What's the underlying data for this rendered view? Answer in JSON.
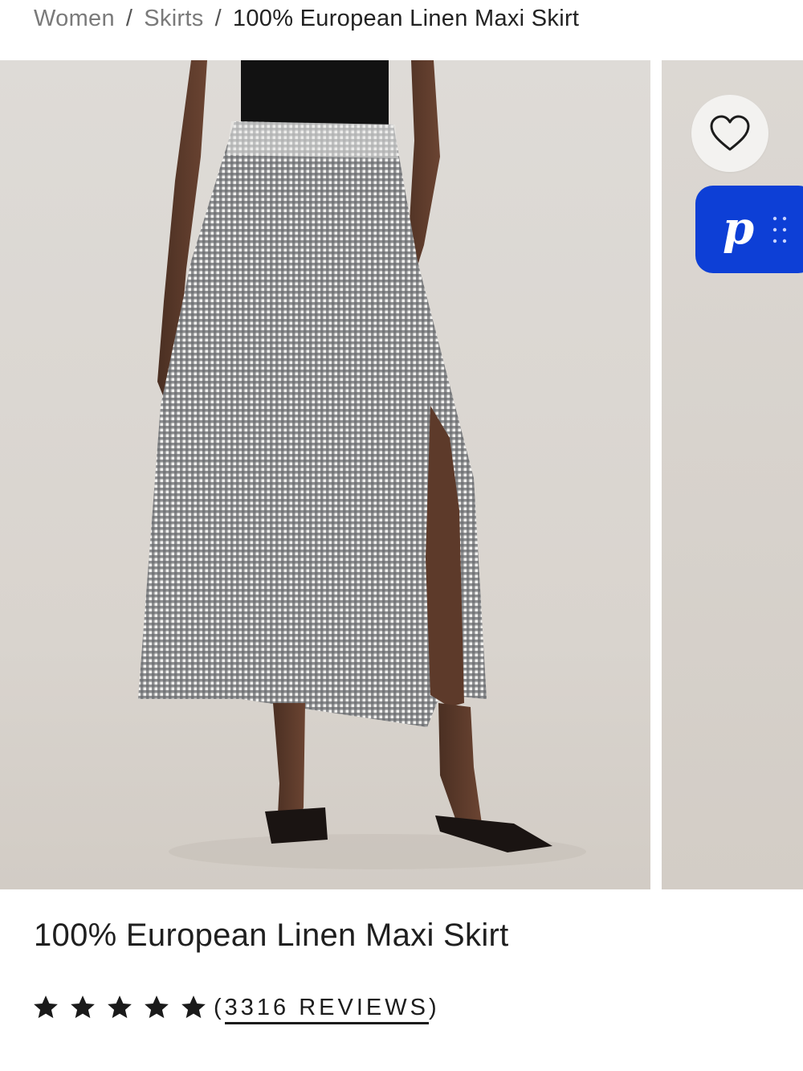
{
  "breadcrumb": {
    "items": [
      "Women",
      "Skirts"
    ],
    "separator": "/",
    "current": "100% European Linen Maxi Skirt"
  },
  "gallery": {
    "favorite_icon": "heart-outline-icon",
    "promo_widget": {
      "letter": "p",
      "icon": "drag-dots-icon",
      "color": "#0d3fd6"
    }
  },
  "product": {
    "title": "100% European Linen Maxi Skirt",
    "rating": {
      "stars": 5,
      "max": 5
    },
    "reviews_open": "(",
    "reviews_label": "3316 REVIEWS",
    "reviews_close": ")"
  }
}
